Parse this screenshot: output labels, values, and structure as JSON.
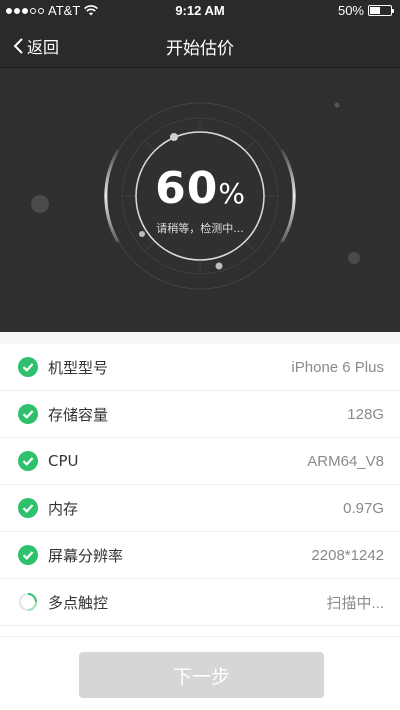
{
  "status_bar": {
    "carrier": "AT&T",
    "time": "9:12 AM",
    "battery_percent": "50%",
    "battery_level": 0.5,
    "signal_bars": 3
  },
  "nav": {
    "back_label": "返回",
    "title": "开始估价"
  },
  "gauge": {
    "percent_value": "60",
    "percent_sign": "%",
    "progress": 0.6,
    "status_text": "请稍等，检测中..."
  },
  "checks": [
    {
      "label": "机型型号",
      "value": "iPhone 6 Plus",
      "state": "done"
    },
    {
      "label": "存储容量",
      "value": "128G",
      "state": "done"
    },
    {
      "label": "CPU",
      "value": "ARM64_V8",
      "state": "done"
    },
    {
      "label": "内存",
      "value": "0.97G",
      "state": "done"
    },
    {
      "label": "屏幕分辨率",
      "value": "2208*1242",
      "state": "done"
    },
    {
      "label": "多点触控",
      "value": "扫描中...",
      "state": "scanning"
    }
  ],
  "footer": {
    "next_label": "下一步"
  },
  "colors": {
    "accent_green": "#2fc06e",
    "dark_bg": "#2f2f2f",
    "button_disabled": "#d6d6d6"
  }
}
